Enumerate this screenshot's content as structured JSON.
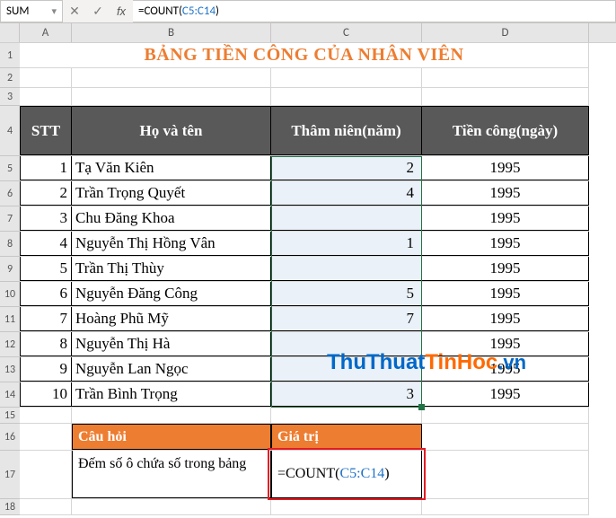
{
  "formula_bar": {
    "name_box": "SUM",
    "cancel_glyph": "✕",
    "enter_glyph": "✓",
    "fx_glyph": "fx",
    "formula_prefix": "=COUNT(",
    "formula_ref": "C5:C14",
    "formula_suffix": ")"
  },
  "columns": {
    "A": "A",
    "B": "B",
    "C": "C",
    "D": "D"
  },
  "rownums": [
    "1",
    "2",
    "3",
    "4",
    "5",
    "6",
    "7",
    "8",
    "9",
    "10",
    "11",
    "12",
    "13",
    "14",
    "15",
    "16",
    "17",
    "18"
  ],
  "title": "BẢNG TIỀN CÔNG CỦA NHÂN VIÊN",
  "headers": {
    "stt": "STT",
    "name": "Họ và tên",
    "years": "Thâm niên(năm)",
    "wage": "Tiền công(ngày)"
  },
  "data": [
    {
      "stt": "1",
      "name": "Tạ Văn Kiên",
      "years": "2",
      "wage": "1995"
    },
    {
      "stt": "2",
      "name": "Trần Trọng Quyết",
      "years": "4",
      "wage": "1995"
    },
    {
      "stt": "3",
      "name": "Chu Đăng Khoa",
      "years": "",
      "wage": "1995"
    },
    {
      "stt": "4",
      "name": "Nguyễn Thị Hồng Vân",
      "years": "1",
      "wage": "1995"
    },
    {
      "stt": "5",
      "name": "Trần Thị Thùy",
      "years": "",
      "wage": "1995"
    },
    {
      "stt": "6",
      "name": "Nguyễn Đăng Công",
      "years": "5",
      "wage": "1995"
    },
    {
      "stt": "7",
      "name": "Hoàng Phũ Mỹ",
      "years": "7",
      "wage": "1995"
    },
    {
      "stt": "8",
      "name": "Nguyễn Thị Hà",
      "years": "",
      "wage": "1995"
    },
    {
      "stt": "9",
      "name": "Nguyễn Lan Ngọc",
      "years": "",
      "wage": "1995"
    },
    {
      "stt": "10",
      "name": "Trần Bình Trọng",
      "years": "3",
      "wage": "1995"
    }
  ],
  "question_section": {
    "q_header": "Câu hỏi",
    "v_header": "Giá trị",
    "question": "Đếm số ô chứa số  trong bảng",
    "formula_prefix": "=COUNT(",
    "formula_ref": "C5:C14",
    "formula_suffix": ")"
  },
  "watermark": {
    "p1": "ThuThuat",
    "p2": "TinHoc",
    "p3": ".vn"
  }
}
